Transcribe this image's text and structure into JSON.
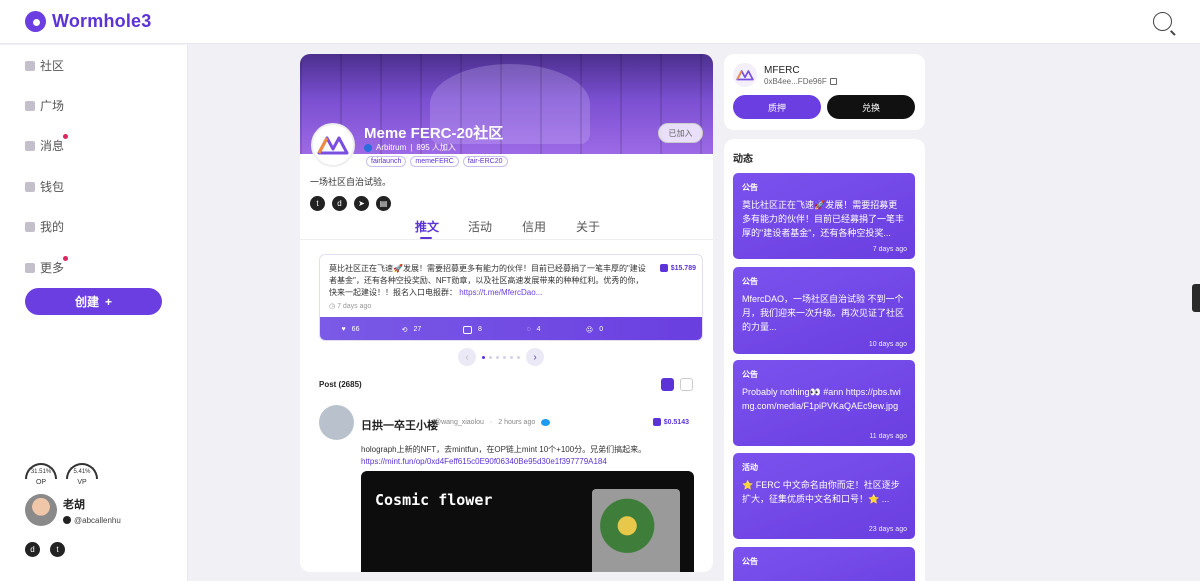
{
  "app": {
    "name": "Wormhole3"
  },
  "sidebar": {
    "items": [
      {
        "label": "社区",
        "icon": "users-icon",
        "dot": false
      },
      {
        "label": "广场",
        "icon": "home-icon",
        "dot": false
      },
      {
        "label": "消息",
        "icon": "bell-icon",
        "dot": true
      },
      {
        "label": "钱包",
        "icon": "wallet-icon",
        "dot": false
      },
      {
        "label": "我的",
        "icon": "person-icon",
        "dot": false
      },
      {
        "label": "更多",
        "icon": "grid-icon",
        "dot": true
      }
    ],
    "create_label": "创建",
    "gauges": [
      {
        "value": "31.51%",
        "label": "OP"
      },
      {
        "value": "5.41%",
        "label": "VP"
      }
    ],
    "user": {
      "name": "老胡",
      "handle": "@abcallenhu"
    }
  },
  "community": {
    "title": "Meme FERC-20社区",
    "chain": "Arbitrum",
    "members": "895 人加入",
    "joined_label": "已加入",
    "tags": [
      "fairlaunch",
      "memeFERC",
      "fair-ERC20"
    ],
    "description": "一场社区自治试验。",
    "tabs": [
      "推文",
      "活动",
      "信用",
      "关于"
    ],
    "featured": {
      "text": "莫比社区正在飞速🚀发展！需要招募更多有能力的伙伴！目前已经募捐了一笔丰厚的\"建设者基金\"，还有各种空投奖励、NFT勋章，以及社区高速发展带来的种种红利。优秀的你，快来一起建设！！报名入口电报群：",
      "link": "https://t.me/MfercDao...",
      "reward": "$15.789",
      "time": "7 days ago",
      "stats": [
        "66",
        "27",
        "8",
        "4",
        "0"
      ]
    },
    "post_count_label": "Post (2685)",
    "post": {
      "author": "日拱一卒王小楼",
      "handle": "@wang_xiaolou",
      "time": "2 hours ago",
      "reward": "$0.5143",
      "text": "holograph上新的NFT，去mintfun，在OP链上mint 10个+100分。兄弟们搞起来。",
      "link": "https://mint.fun/op/0xd4Feff615c0E90f06340Be95d30e1f397779A184",
      "media_title": "Cosmic flower"
    }
  },
  "token": {
    "name": "MFERC",
    "address": "0xB4ee...FDe96F",
    "stake_label": "质押",
    "swap_label": "兑换"
  },
  "activity": {
    "title": "动态",
    "items": [
      {
        "type": "公告",
        "text": "莫比社区正在飞速🚀发展！需要招募更多有能力的伙伴！目前已经募捐了一笔丰厚的\"建设者基金\"，还有各种空投奖...",
        "time": "7 days ago"
      },
      {
        "type": "公告",
        "text": "MfercDAO，一场社区自治试验 不到一个月，我们迎来一次升级。再次见证了社区的力量...",
        "time": "10 days ago"
      },
      {
        "type": "公告",
        "text": "Probably nothing👀 #ann https://pbs.twimg.com/media/F1piPVKaQAEc9ew.jpg",
        "time": "11 days ago"
      },
      {
        "type": "活动",
        "text": "⭐ FERC 中文命名由你而定！社区逐步扩大，征集优质中文名和口号！⭐ ...",
        "time": "23 days ago"
      },
      {
        "type": "公告",
        "text": "",
        "time": ""
      }
    ]
  }
}
